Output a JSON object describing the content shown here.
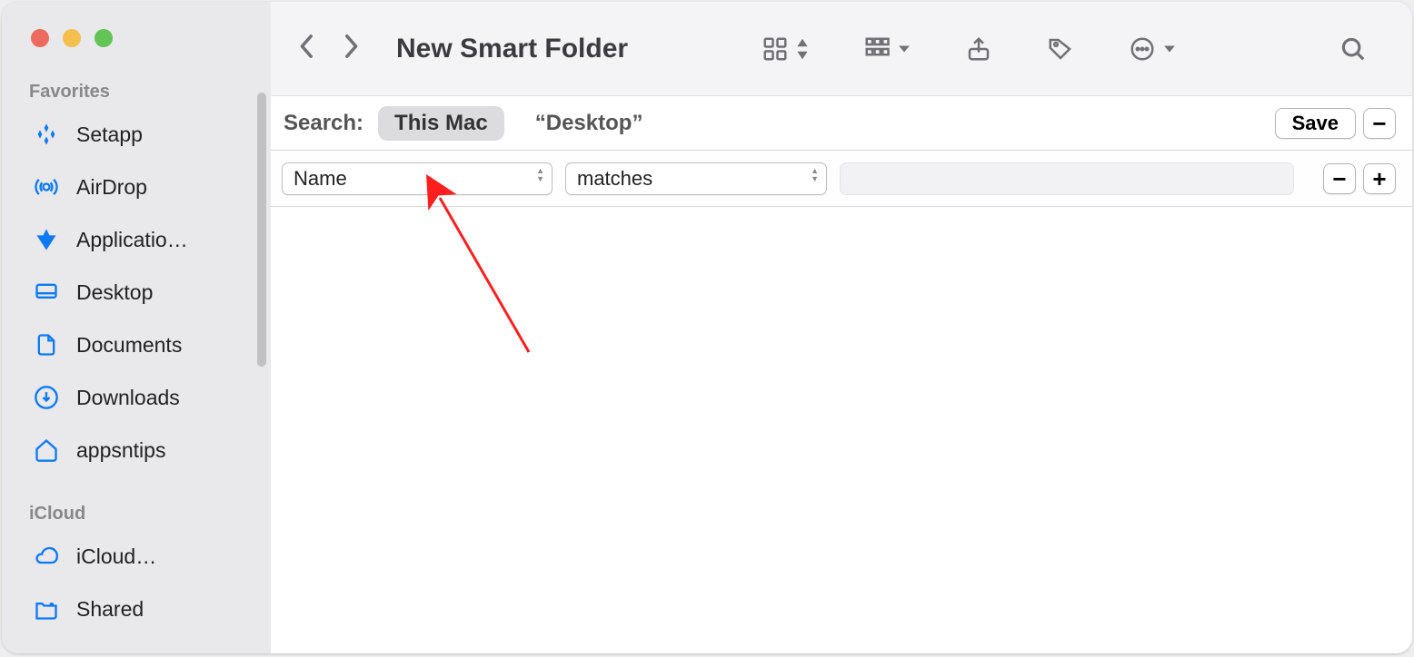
{
  "window_title": "New Smart Folder",
  "sidebar": {
    "sections": [
      {
        "label": "Favorites",
        "items": [
          {
            "label": "Setapp",
            "icon": "setapp"
          },
          {
            "label": "AirDrop",
            "icon": "airdrop"
          },
          {
            "label": "Applicatio…",
            "icon": "applications"
          },
          {
            "label": "Desktop",
            "icon": "desktop"
          },
          {
            "label": "Documents",
            "icon": "documents"
          },
          {
            "label": "Downloads",
            "icon": "downloads"
          },
          {
            "label": "appsntips",
            "icon": "home"
          }
        ]
      },
      {
        "label": "iCloud",
        "items": [
          {
            "label": "iCloud…",
            "icon": "cloud"
          },
          {
            "label": "Shared",
            "icon": "shared"
          }
        ]
      }
    ]
  },
  "scope": {
    "label": "Search:",
    "options": [
      "This Mac",
      "“Desktop”"
    ],
    "active_index": 0,
    "save_label": "Save",
    "minus": "−"
  },
  "filter": {
    "attribute": "Name",
    "operator": "matches",
    "value": "",
    "minus": "−",
    "plus": "+"
  }
}
